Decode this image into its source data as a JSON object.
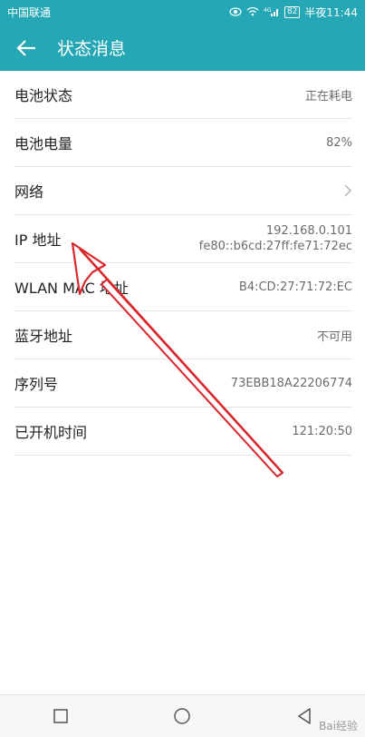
{
  "status_bar": {
    "carrier": "中国联通",
    "signal_label": "4G",
    "battery": "82",
    "time": "半夜11:44"
  },
  "app_bar": {
    "title": "状态消息"
  },
  "rows": [
    {
      "label": "电池状态",
      "value": "正在耗电"
    },
    {
      "label": "电池电量",
      "value": "82%"
    },
    {
      "label": "网络",
      "value": ""
    },
    {
      "label": "IP 地址",
      "value": "192.168.0.101",
      "value2": "fe80::b6cd:27ff:fe71:72ec"
    },
    {
      "label": "WLAN MAC 地址",
      "value": "B4:CD:27:71:72:EC"
    },
    {
      "label": "蓝牙地址",
      "value": "不可用"
    },
    {
      "label": "序列号",
      "value": "73EBB18A22206774"
    },
    {
      "label": "已开机时间",
      "value": "121:20:50"
    }
  ],
  "watermark": "Bai经验",
  "colors": {
    "accent": "#25a7b6",
    "arrow": "#d9262a"
  }
}
